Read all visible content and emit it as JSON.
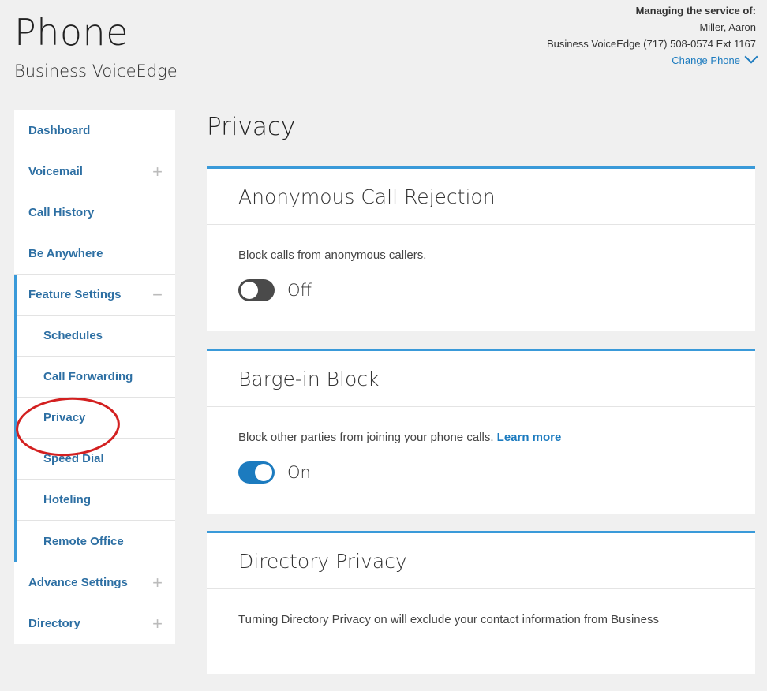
{
  "header": {
    "title": "Phone",
    "subtitle": "Business VoiceEdge"
  },
  "account": {
    "heading": "Managing the service of:",
    "name": "Miller, Aaron",
    "service": "Business VoiceEdge (717) 508-0574 Ext 1167",
    "change_label": "Change Phone"
  },
  "sidebar": {
    "items": [
      {
        "label": "Dashboard"
      },
      {
        "label": "Voicemail"
      },
      {
        "label": "Call History"
      },
      {
        "label": "Be Anywhere"
      },
      {
        "label": "Feature Settings"
      },
      {
        "label": "Schedules"
      },
      {
        "label": "Call Forwarding"
      },
      {
        "label": "Privacy"
      },
      {
        "label": "Speed Dial"
      },
      {
        "label": "Hoteling"
      },
      {
        "label": "Remote Office"
      },
      {
        "label": "Advance Settings"
      },
      {
        "label": "Directory"
      }
    ]
  },
  "main": {
    "title": "Privacy",
    "cards": [
      {
        "title": "Anonymous Call Rejection",
        "description": "Block calls from anonymous callers.",
        "toggle_label": "Off"
      },
      {
        "title": "Barge-in Block",
        "description": "Block other parties from joining your phone calls.",
        "link": "Learn more",
        "toggle_label": "On"
      },
      {
        "title": "Directory Privacy",
        "description": "Turning Directory Privacy on will exclude your contact information from Business"
      }
    ]
  },
  "colors": {
    "accent": "#1c7bbf",
    "nav_text": "#2d6fa3",
    "highlight": "#d32020",
    "toggle_off": "#4a4a4a"
  }
}
